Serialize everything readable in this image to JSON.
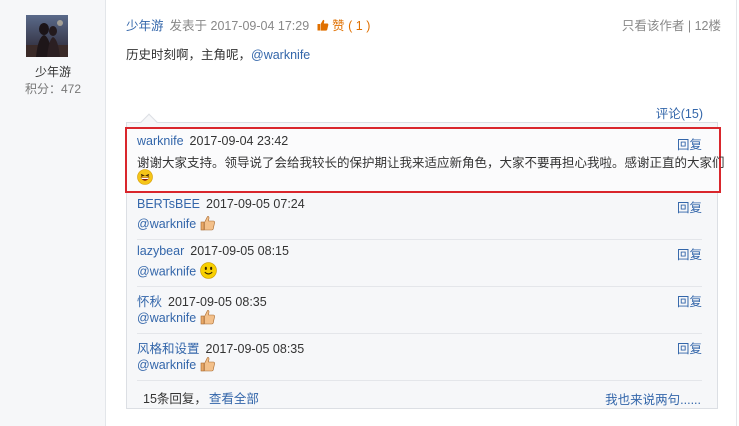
{
  "user": {
    "name": "少年游",
    "score": "积分：472"
  },
  "post": {
    "author": "少年游",
    "meta": "发表于 2017-09-04 17:29",
    "like_label": "赞",
    "like_count": "( 1 )",
    "only_author": "只看该作者",
    "floor": "| 12楼",
    "content_text": "历史时刻啊，主角呢，",
    "mention": "@warknife"
  },
  "comments": {
    "count_label": "评论(15)",
    "replies": [
      {
        "name": "warknife",
        "time": "2017-09-04 23:42",
        "text": "谢谢大家支持。领导说了会给我较长的保护期让我来适应新角色，大家不要再担心我啦。感谢正直的大家们",
        "emoji": "laughing-emoji",
        "reply_label": "回复"
      },
      {
        "name": "BERTsBEE",
        "time": "2017-09-05 07:24",
        "text": "@warknife",
        "emoji": "thumbs-up-emoji",
        "reply_label": "回复"
      },
      {
        "name": "lazybear",
        "time": "2017-09-05 08:15",
        "text": "@warknife",
        "emoji": "smile-emoji",
        "reply_label": "回复"
      },
      {
        "name": "怀秋",
        "time": "2017-09-05 08:35",
        "text": "@warknife",
        "emoji": "thumbs-up-emoji",
        "reply_label": "回复"
      },
      {
        "name": "风格和设置",
        "time": "2017-09-05 08:35",
        "text": "@warknife",
        "emoji": "thumbs-up-emoji",
        "reply_label": "回复"
      }
    ],
    "footer_count": "15条回复，",
    "footer_view_all": "查看全部",
    "footer_add": "我也来说两句......"
  },
  "colors": {
    "link": "#3366aa",
    "highlight_border": "#d9262c",
    "like": "#e07000"
  }
}
